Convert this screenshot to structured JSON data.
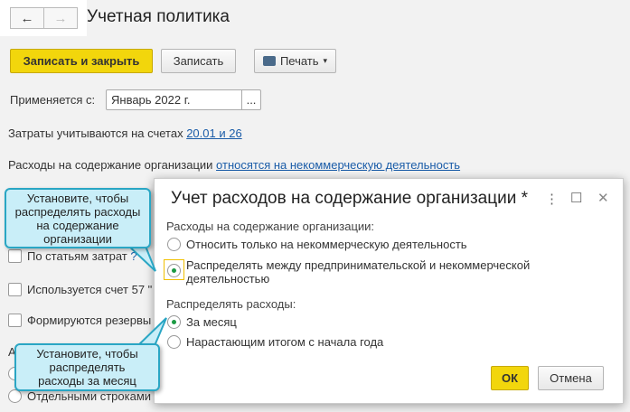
{
  "header": {
    "title": "Учетная политика",
    "back": "←",
    "forward": "→"
  },
  "toolbar": {
    "save_close": "Записать и закрыть",
    "save": "Записать",
    "print": "Печать",
    "print_arrow": "▾"
  },
  "form": {
    "applies_label": "Применяется с:",
    "applies_value": "Январь 2022 г.",
    "applies_select": "...",
    "costs_text": "Затраты учитываются на счетах",
    "costs_link": "20.01 и 26",
    "maint_text": "Расходы на содержание организации",
    "maint_link": "относятся на некоммерческую деятельность",
    "cb1": "По статьям затрат",
    "cb1_help": "?",
    "cb2": "Используется счет 57 \"",
    "cb3": "Формируются резервы",
    "group_label": "А",
    "radio_last": "Отдельными строками"
  },
  "dialog": {
    "title": "Учет расходов на содержание организации *",
    "more": "⋮",
    "maximize": "☐",
    "close": "✕",
    "group1_label": "Расходы на содержание организации:",
    "group1_options": [
      "Относить только на некоммерческую деятельность",
      "Распределять между предпринимательской и некоммерческой деятельностью"
    ],
    "group1_selected": 1,
    "group2_label": "Распределять расходы:",
    "group2_options": [
      "За месяц",
      "Нарастающим итогом с начала года"
    ],
    "group2_selected": 0,
    "ok": "ОК",
    "cancel": "Отмена"
  },
  "callouts": [
    "Установите, чтобы распределять расходы на содержание организации",
    "Установите, чтобы распределять расходы за месяц"
  ],
  "colors": {
    "primary": "#f2d60c",
    "link": "#1a5ca8",
    "radio_on": "#1c9a43",
    "callout_bg": "#c9eef8",
    "callout_border": "#2aa6c4"
  }
}
